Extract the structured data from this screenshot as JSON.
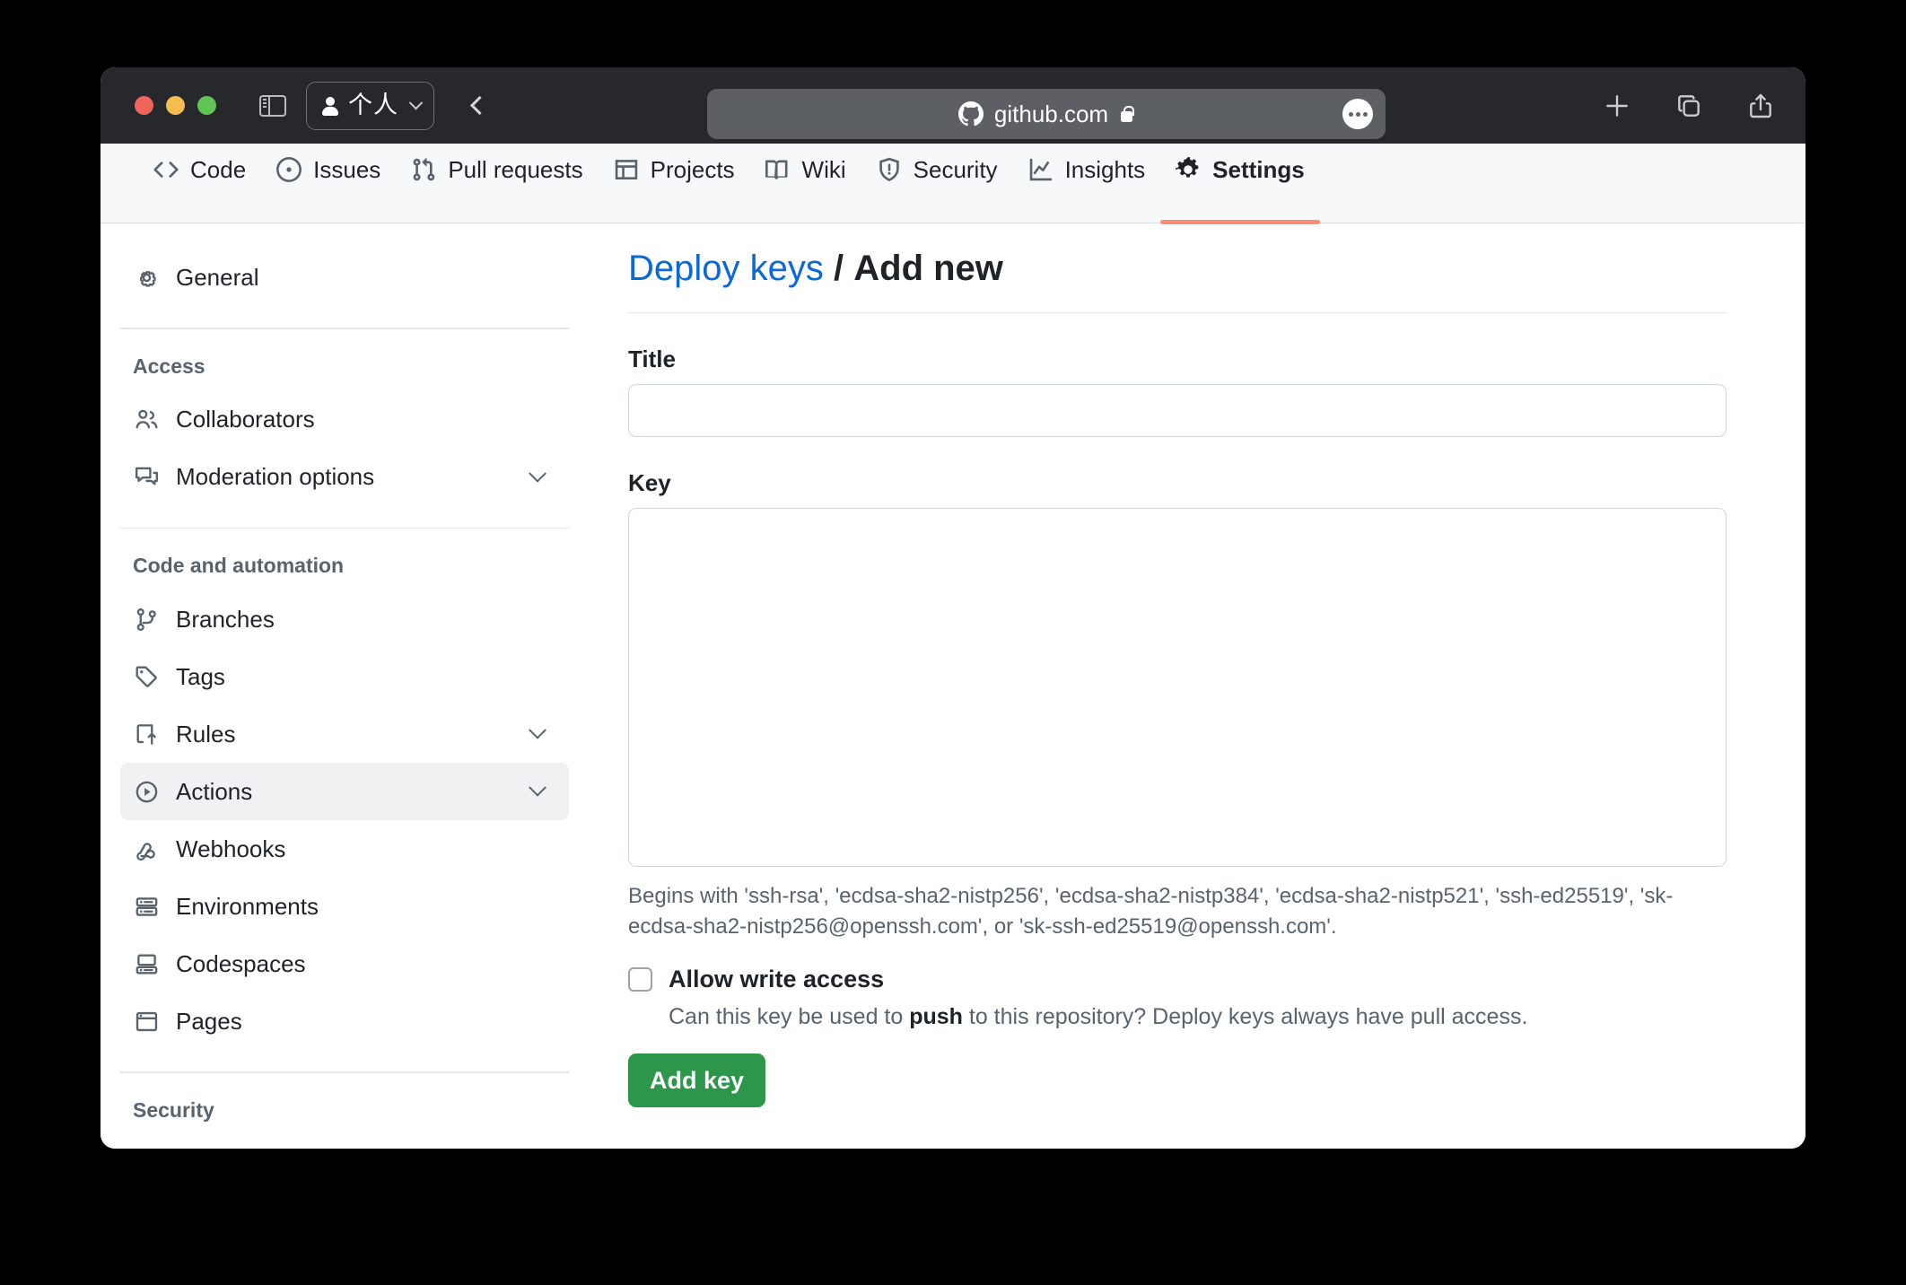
{
  "browser": {
    "traffic_lights": [
      "close",
      "minimize",
      "zoom"
    ],
    "sidebar_toggle_icon": "sidebar-icon",
    "profile_label": "个人",
    "profile_icon": "person-icon",
    "back_icon": "chevron-left-icon",
    "url": "github.com",
    "url_site_icon": "github-mark-icon",
    "url_lock_icon": "lock-icon",
    "more_icon": "ellipsis-icon",
    "right_actions": [
      {
        "name": "new-tab-button",
        "icon": "plus-icon"
      },
      {
        "name": "tab-overview-button",
        "icon": "copy-tabs-icon"
      },
      {
        "name": "share-button",
        "icon": "share-icon"
      }
    ]
  },
  "repo_nav": {
    "tabs": [
      {
        "label": "Code",
        "icon": "code-icon",
        "selected": false
      },
      {
        "label": "Issues",
        "icon": "issue-opened-icon",
        "selected": false
      },
      {
        "label": "Pull requests",
        "icon": "git-pull-request-icon",
        "selected": false
      },
      {
        "label": "Projects",
        "icon": "table-icon",
        "selected": false
      },
      {
        "label": "Wiki",
        "icon": "book-icon",
        "selected": false
      },
      {
        "label": "Security",
        "icon": "shield-icon",
        "selected": false
      },
      {
        "label": "Insights",
        "icon": "graph-icon",
        "selected": false
      },
      {
        "label": "Settings",
        "icon": "gear-icon",
        "selected": true
      }
    ],
    "selected_underline_color": "#fd8c73"
  },
  "sidebar": {
    "top_items": [
      {
        "label": "General",
        "icon": "gear-icon",
        "expandable": false,
        "active": false
      }
    ],
    "sections": [
      {
        "heading": "Access",
        "items": [
          {
            "label": "Collaborators",
            "icon": "people-icon",
            "expandable": false,
            "active": false
          },
          {
            "label": "Moderation options",
            "icon": "comment-discussion-icon",
            "expandable": true,
            "active": false
          }
        ]
      },
      {
        "heading": "Code and automation",
        "items": [
          {
            "label": "Branches",
            "icon": "git-branch-icon",
            "expandable": false,
            "active": false
          },
          {
            "label": "Tags",
            "icon": "tag-icon",
            "expandable": false,
            "active": false
          },
          {
            "label": "Rules",
            "icon": "rules-icon",
            "expandable": true,
            "active": false
          },
          {
            "label": "Actions",
            "icon": "play-circle-icon",
            "expandable": true,
            "active": true
          },
          {
            "label": "Webhooks",
            "icon": "webhook-icon",
            "expandable": false,
            "active": false
          },
          {
            "label": "Environments",
            "icon": "server-icon",
            "expandable": false,
            "active": false
          },
          {
            "label": "Codespaces",
            "icon": "codespaces-icon",
            "expandable": false,
            "active": false
          },
          {
            "label": "Pages",
            "icon": "browser-icon",
            "expandable": false,
            "active": false
          }
        ]
      },
      {
        "heading": "Security",
        "items": []
      }
    ]
  },
  "main": {
    "heading": {
      "link": "Deploy keys",
      "separator": "/",
      "current": "Add new"
    },
    "title_field": {
      "label": "Title",
      "value": "",
      "placeholder": ""
    },
    "key_field": {
      "label": "Key",
      "value": "",
      "placeholder": "",
      "hint": "Begins with 'ssh-rsa', 'ecdsa-sha2-nistp256', 'ecdsa-sha2-nistp384', 'ecdsa-sha2-nistp521', 'ssh-ed25519', 'sk-ecdsa-sha2-nistp256@openssh.com', or 'sk-ssh-ed25519@openssh.com'."
    },
    "write_access": {
      "label": "Allow write access",
      "checked": false,
      "description_before": "Can this key be used to ",
      "description_bold": "push",
      "description_after": " to this repository? Deploy keys always have pull access."
    },
    "submit_label": "Add key",
    "submit_color": "#2c974b"
  }
}
